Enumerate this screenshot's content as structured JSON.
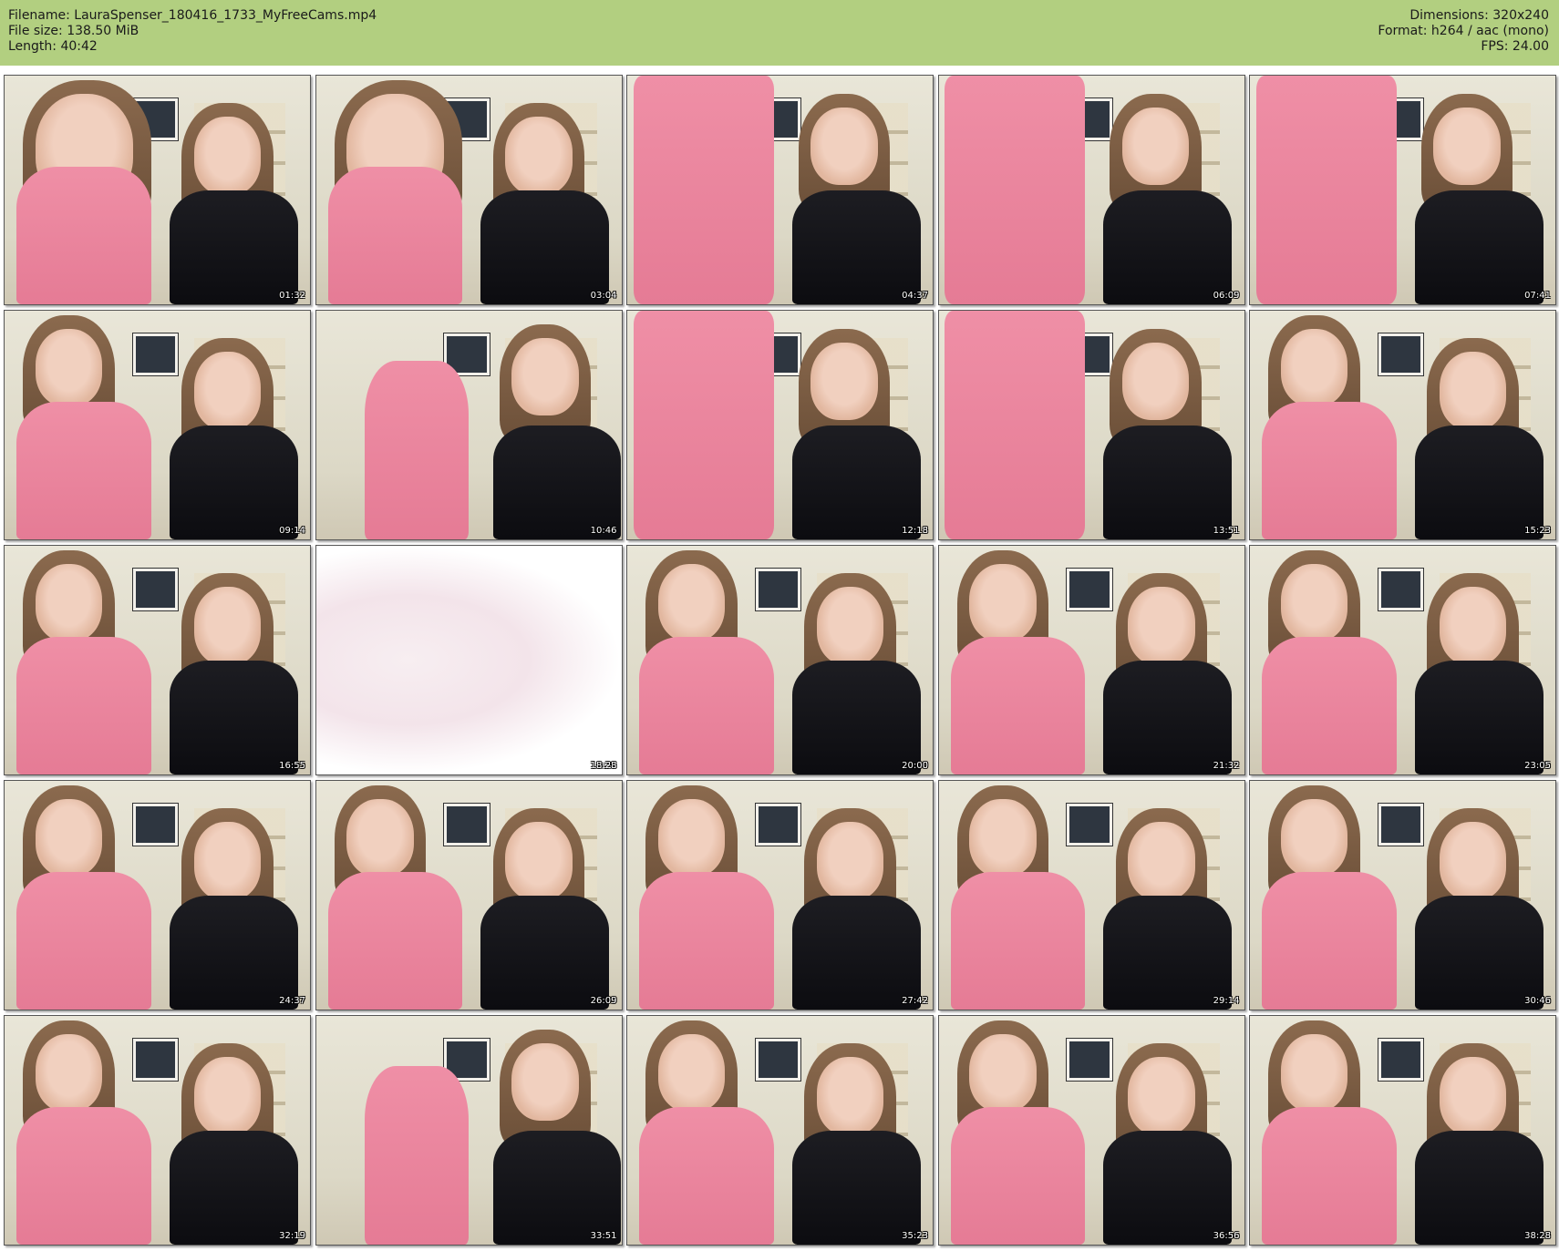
{
  "header": {
    "filename_line": "Filename: LauraSpenser_180416_1733_MyFreeCams.mp4",
    "filesize_line": "File size: 138.50 MiB",
    "length_line": "Length: 40:42",
    "dimensions_line": "Dimensions: 320x240",
    "format_line": "Format: h264 / aac (mono)",
    "fps_line": "FPS: 24.00",
    "background_color": "#b2cf80"
  },
  "thumbnails": [
    {
      "timestamp": "01:32",
      "scene": "closeup-both"
    },
    {
      "timestamp": "03:04",
      "scene": "laughing"
    },
    {
      "timestamp": "04:37",
      "scene": "pink-torso"
    },
    {
      "timestamp": "06:09",
      "scene": "pink-torso"
    },
    {
      "timestamp": "07:41",
      "scene": "pink-torso"
    },
    {
      "timestamp": "09:14",
      "scene": "both-seated"
    },
    {
      "timestamp": "10:46",
      "scene": "standing"
    },
    {
      "timestamp": "12:18",
      "scene": "pink-torso"
    },
    {
      "timestamp": "13:51",
      "scene": "pink-torso"
    },
    {
      "timestamp": "15:23",
      "scene": "both-seated"
    },
    {
      "timestamp": "16:55",
      "scene": "both-seated"
    },
    {
      "timestamp": "18:28",
      "scene": "blank"
    },
    {
      "timestamp": "20:00",
      "scene": "both-seated"
    },
    {
      "timestamp": "21:32",
      "scene": "both-seated"
    },
    {
      "timestamp": "23:05",
      "scene": "both-seated"
    },
    {
      "timestamp": "24:37",
      "scene": "both-seated"
    },
    {
      "timestamp": "26:09",
      "scene": "both-seated"
    },
    {
      "timestamp": "27:42",
      "scene": "both-seated"
    },
    {
      "timestamp": "29:14",
      "scene": "both-seated"
    },
    {
      "timestamp": "30:46",
      "scene": "both-seated"
    },
    {
      "timestamp": "32:19",
      "scene": "both-seated"
    },
    {
      "timestamp": "33:51",
      "scene": "standing"
    },
    {
      "timestamp": "35:23",
      "scene": "both-seated"
    },
    {
      "timestamp": "36:56",
      "scene": "both-seated"
    },
    {
      "timestamp": "38:28",
      "scene": "both-seated"
    }
  ]
}
